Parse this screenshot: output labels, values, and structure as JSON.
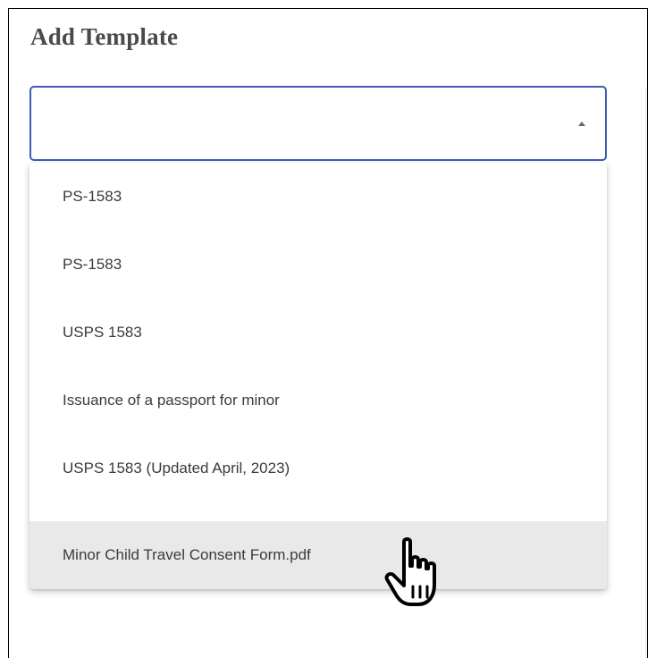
{
  "dialog": {
    "title": "Add Template"
  },
  "template_select": {
    "value": "",
    "expanded": true,
    "options": [
      "PS-1583",
      "PS-1583",
      "USPS 1583",
      "Issuance of a passport for minor",
      "USPS 1583 (Updated April, 2023)",
      "Minor Child Travel Consent Form.pdf"
    ],
    "hovered_index": 5
  },
  "colors": {
    "accent_border": "#3f5bb4",
    "hover_background": "#e9e9e9",
    "title_text": "#4a4a4a"
  },
  "icons": {
    "select_caret": "caret-up-icon",
    "pointer": "hand-pointer-cursor"
  }
}
